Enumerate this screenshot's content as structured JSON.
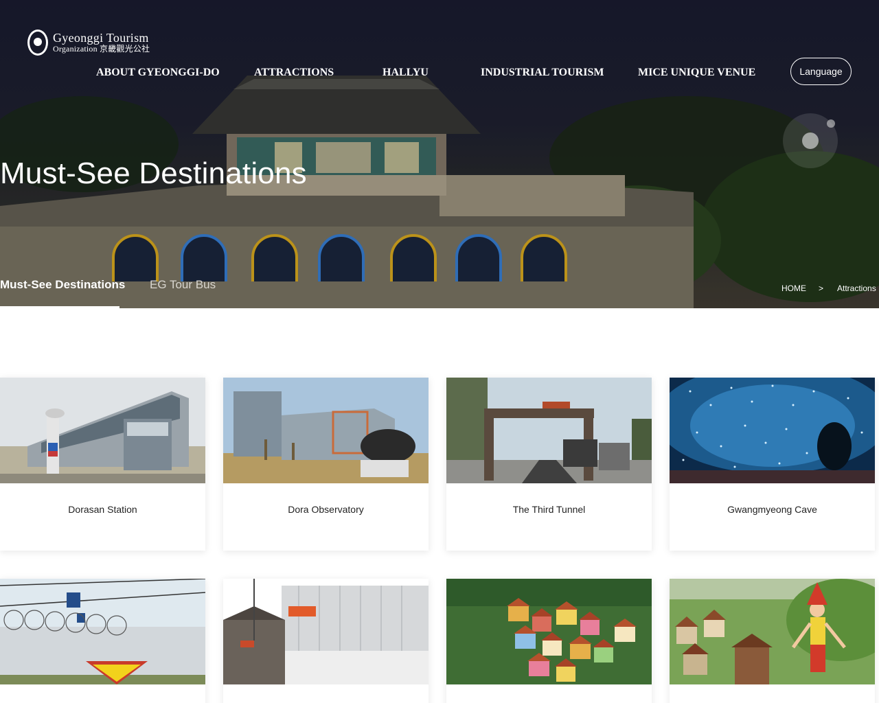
{
  "logo": {
    "line1": "Gyeonggi Tourism",
    "line2": "Organization 京畿觀光公社"
  },
  "nav": {
    "items": [
      {
        "label": "ABOUT GYEONGGI-DO"
      },
      {
        "label": "ATTRACTIONS"
      },
      {
        "label": "HALLYU"
      },
      {
        "label": "INDUSTRIAL TOURISM"
      },
      {
        "label": "MICE UNIQUE VENUE"
      }
    ],
    "language_label": "Language"
  },
  "hero": {
    "title": "Must-See Destinations"
  },
  "subtabs": [
    {
      "label": "Must-See Destinations",
      "active": true
    },
    {
      "label": "EG Tour Bus",
      "active": false
    }
  ],
  "breadcrumb": {
    "home": "HOME",
    "separator": ">",
    "current": "Attractions"
  },
  "cards": [
    {
      "title": "Dorasan Station",
      "image": "station-photo"
    },
    {
      "title": "Dora Observatory",
      "image": "observatory-photo"
    },
    {
      "title": "The Third Tunnel",
      "image": "tunnel-gate-photo"
    },
    {
      "title": "Gwangmyeong Cave",
      "image": "cave-lights-photo"
    },
    {
      "title": "",
      "image": "cable-car-photo"
    },
    {
      "title": "",
      "image": "warehouse-photo"
    },
    {
      "title": "",
      "image": "colorful-village-photo"
    },
    {
      "title": "",
      "image": "pinocchio-village-photo"
    }
  ],
  "colors": {
    "hero_dark": "#1b1d33",
    "text_dark": "#222222",
    "white": "#ffffff"
  }
}
